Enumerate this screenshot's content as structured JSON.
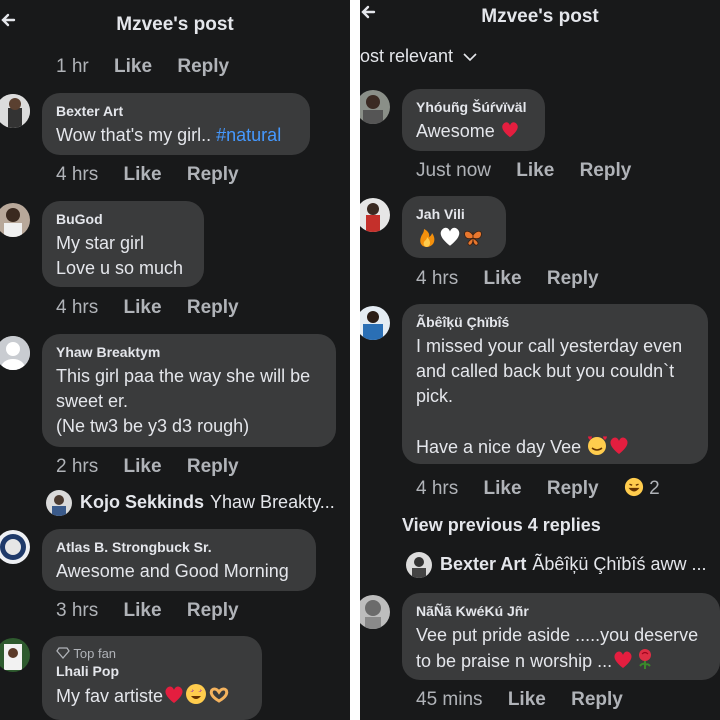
{
  "left": {
    "title": "Mzvee's post",
    "top_actions": {
      "time": "1 hr",
      "like": "Like",
      "reply": "Reply"
    },
    "comments": [
      {
        "name": "Bexter Art",
        "text": "Wow that's my girl.. ",
        "hashtag": "#natural",
        "time": "4 hrs",
        "like": "Like",
        "reply": "Reply"
      },
      {
        "name": "BuGod",
        "line1": "My star girl",
        "line2": "Love u so much",
        "time": "4 hrs",
        "like": "Like",
        "reply": "Reply"
      },
      {
        "name": "Yhaw Breaktym",
        "line1": "This girl paa the way she will be",
        "line2": "sweet er.",
        "line3": "(Ne tw3 be y3 d3 rough)",
        "time": "2 hrs",
        "like": "Like",
        "reply": "Reply"
      },
      {
        "name": "Atlas B. Strongbuck Sr.",
        "text": "Awesome and Good Morning",
        "time": "3 hrs",
        "like": "Like",
        "reply": "Reply"
      },
      {
        "badge": "Top fan",
        "name": "Lhali Pop",
        "text": "My fav artiste"
      }
    ],
    "reply_preview": {
      "name": "Kojo Sekkinds",
      "text": "Yhaw Breakty..."
    }
  },
  "right": {
    "title": "Mzvee's post",
    "sort_label": "lost relevant",
    "comments": [
      {
        "name": "Yhóuñg Šúŕvïväl",
        "text": "Awesome",
        "time": "Just now",
        "like": "Like",
        "reply": "Reply"
      },
      {
        "name": "Jah Vili",
        "time": "4 hrs",
        "like": "Like",
        "reply": "Reply"
      },
      {
        "name": "Ãbêîķü Çhïbîś",
        "line1": "I missed your call yesterday even",
        "line2": "and called back but you couldn`t",
        "line3": "pick.",
        "line4": "Have a nice day Vee",
        "time": "4 hrs",
        "like": "Like",
        "reply": "Reply",
        "reaction_count": "2"
      },
      {
        "name": "NãÑã KwéKú Jñr",
        "line1": "Vee put pride aside .....you deserve",
        "line2": "to be praise n worship ...",
        "time": "45 mins",
        "like": "Like",
        "reply": "Reply"
      }
    ],
    "view_previous": "View previous 4 replies",
    "reply_preview": {
      "name": "Bexter Art",
      "text": "Ãbêîķü Çhïbîś aww ..."
    }
  },
  "colors": {
    "background": "#18191a",
    "bubble": "#3a3b3c",
    "text": "#e4e6eb",
    "muted": "#b0b3b8",
    "hashtag": "#4599ff",
    "heart": "#e41e3f"
  }
}
